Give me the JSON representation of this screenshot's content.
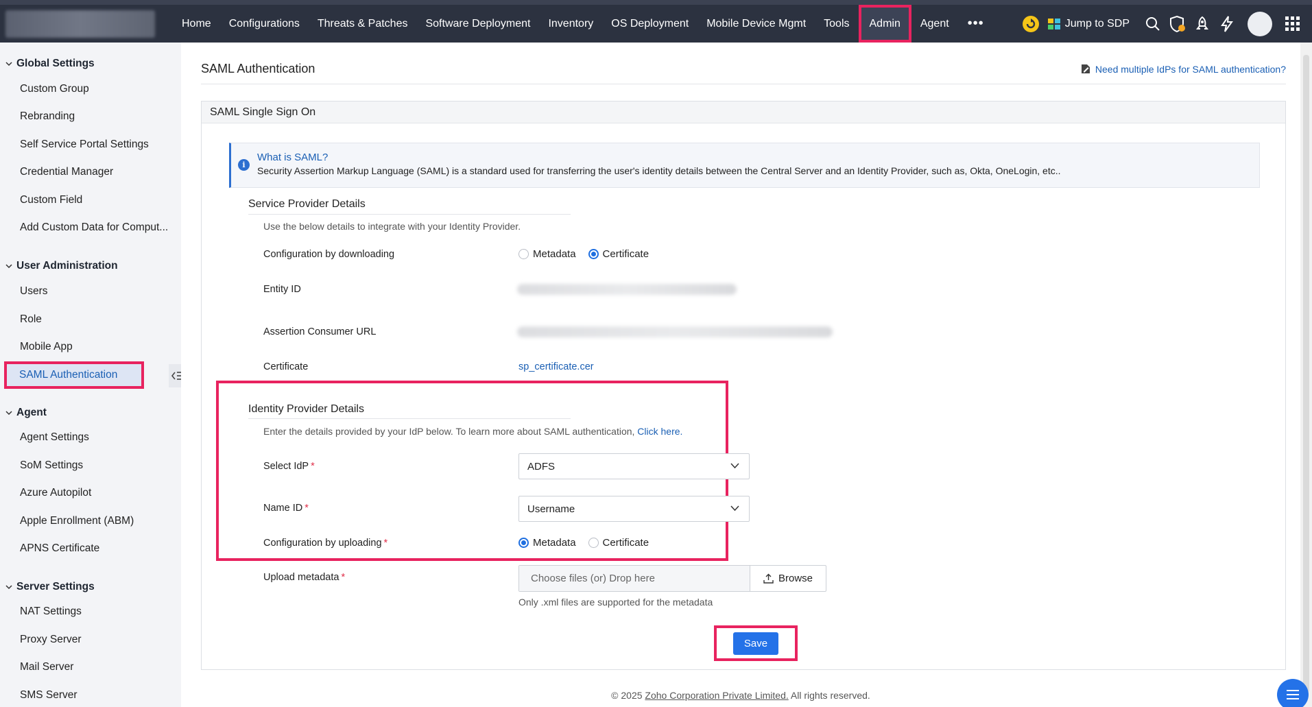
{
  "nav": {
    "items": [
      "Home",
      "Configurations",
      "Threats & Patches",
      "Software Deployment",
      "Inventory",
      "OS Deployment",
      "Mobile Device Mgmt",
      "Tools",
      "Admin",
      "Agent"
    ],
    "active": "Admin",
    "more": "•••",
    "jump_label": "Jump to SDP"
  },
  "sidebar": {
    "global_settings": {
      "title": "Global Settings",
      "items": [
        "Custom Group",
        "Rebranding",
        "Self Service Portal Settings",
        "Credential Manager",
        "Custom Field",
        "Add Custom Data for Comput..."
      ]
    },
    "user_admin": {
      "title": "User Administration",
      "items": [
        "Users",
        "Role",
        "Mobile App",
        "SAML Authentication"
      ]
    },
    "agent": {
      "title": "Agent",
      "items": [
        "Agent Settings",
        "SoM Settings",
        "Azure Autopilot",
        "Apple Enrollment (ABM)",
        "APNS Certificate"
      ]
    },
    "server_settings": {
      "title": "Server Settings",
      "items": [
        "NAT Settings",
        "Proxy Server",
        "Mail Server",
        "SMS Server"
      ]
    }
  },
  "page": {
    "title": "SAML Authentication",
    "multi_idp_link": "Need multiple IdPs for SAML authentication?",
    "panel_title": "SAML Single Sign On",
    "info": {
      "title": "What is SAML?",
      "text": "Security Assertion Markup Language (SAML) is a standard used for transferring the user's identity details between the Central Server and an Identity Provider, such as, Okta, OneLogin, etc.."
    },
    "sp": {
      "heading": "Service Provider Details",
      "desc": "Use the below details to integrate with your Identity Provider.",
      "config_label": "Configuration by downloading",
      "config_options": [
        "Metadata",
        "Certificate"
      ],
      "config_selected": "Certificate",
      "entity_label": "Entity ID",
      "acs_label": "Assertion Consumer URL",
      "cert_label": "Certificate",
      "cert_link": "sp_certificate.cer"
    },
    "idp": {
      "heading": "Identity Provider Details",
      "desc": "Enter the details provided by your IdP below. To learn more about SAML authentication,",
      "desc_link": "Click here.",
      "select_idp_label": "Select IdP",
      "select_idp_value": "ADFS",
      "name_id_label": "Name ID",
      "name_id_value": "Username",
      "config_label": "Configuration by uploading",
      "config_options": [
        "Metadata",
        "Certificate"
      ],
      "config_selected": "Metadata",
      "upload_label": "Upload metadata",
      "upload_placeholder": "Choose files (or) Drop here",
      "browse_label": "Browse",
      "upload_hint": "Only .xml files are supported for the metadata",
      "required_mark": "*"
    },
    "save_label": "Save",
    "footer": {
      "prefix": "© 2025 ",
      "corp": "Zoho Corporation Private Limited.",
      "suffix": " All rights reserved."
    }
  },
  "colors": {
    "topbar": "#2c3240",
    "highlight": "#e8235f",
    "accent": "#2472e8",
    "link": "#1a5fb4"
  }
}
